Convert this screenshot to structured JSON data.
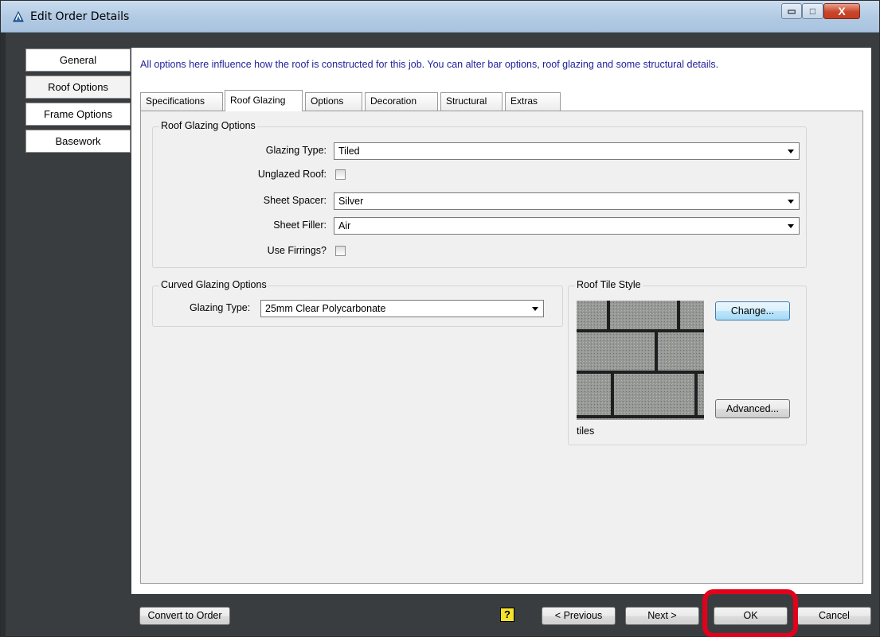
{
  "window": {
    "title": "Edit Order Details",
    "controls": {
      "minimize": "▭",
      "maximize": "□",
      "close": "X"
    }
  },
  "side_tabs": [
    {
      "label": "General"
    },
    {
      "label": "Roof Options",
      "active": true
    },
    {
      "label": "Frame Options"
    },
    {
      "label": "Basework"
    }
  ],
  "intro_text": "All options here influence how the roof is constructed for this job. You can alter bar options, roof glazing and some structural details.",
  "inner_tabs": [
    {
      "label": "Specifications"
    },
    {
      "label": "Roof Glazing",
      "active": true
    },
    {
      "label": "Options"
    },
    {
      "label": "Decoration"
    },
    {
      "label": "Structural"
    },
    {
      "label": "Extras"
    }
  ],
  "roof_glazing": {
    "legend": "Roof Glazing Options",
    "glazing_type_label": "Glazing Type:",
    "glazing_type_value": "Tiled",
    "unglazed_label": "Unglazed Roof:",
    "unglazed_checked": false,
    "sheet_spacer_label": "Sheet Spacer:",
    "sheet_spacer_value": "Silver",
    "sheet_filler_label": "Sheet Filler:",
    "sheet_filler_value": "Air",
    "firrings_label": "Use Firrings?",
    "firrings_checked": false
  },
  "curved_glazing": {
    "legend": "Curved Glazing Options",
    "glazing_type_label": "Glazing Type:",
    "glazing_type_value": "25mm Clear Polycarbonate"
  },
  "roof_tile": {
    "legend": "Roof Tile Style",
    "change_label": "Change...",
    "advanced_label": "Advanced...",
    "tile_name": "tiles"
  },
  "footer": {
    "convert_label": "Convert to Order",
    "help_label": "?",
    "previous_label": "< Previous",
    "next_label": "Next >",
    "ok_label": "OK",
    "cancel_label": "Cancel"
  },
  "colors": {
    "intro_text": "#1f1f9a",
    "highlight": "#e3001b",
    "frame": "#3a3d40"
  }
}
